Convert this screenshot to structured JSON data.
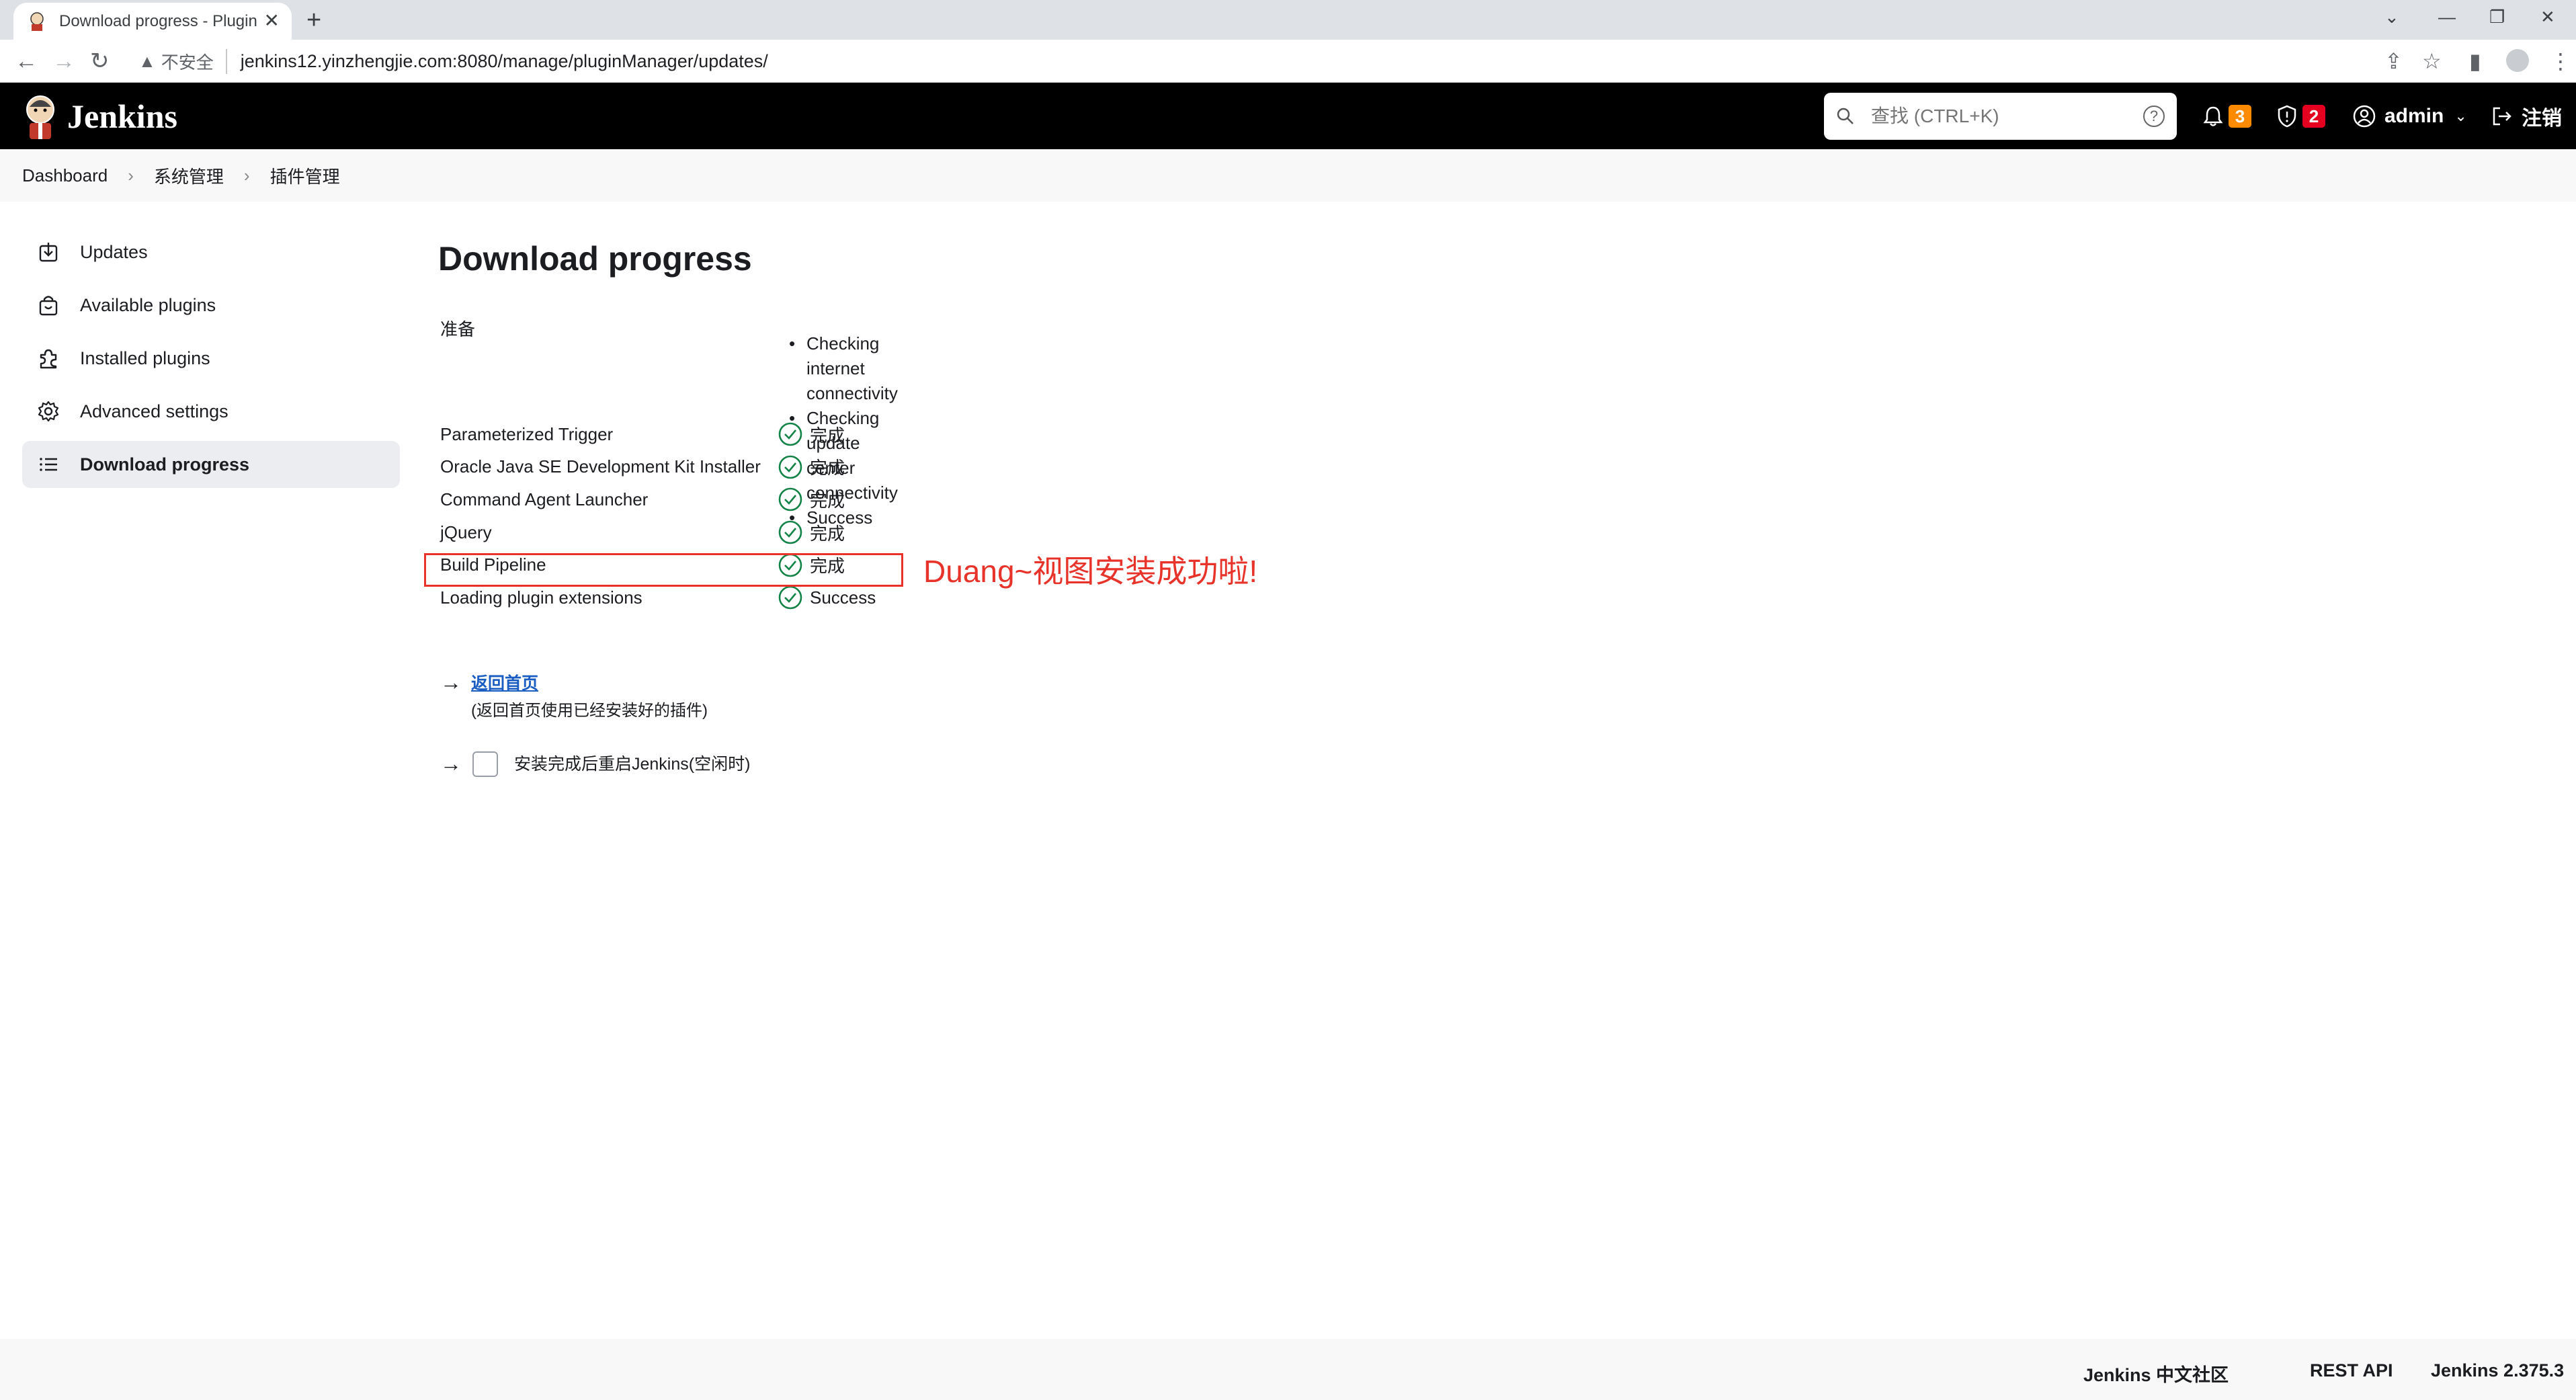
{
  "browser": {
    "tab_title": "Download progress - Plugin M",
    "insecure_label": "不安全",
    "url": "jenkins12.yinzhengjie.com:8080/manage/pluginManager/updates/"
  },
  "header": {
    "brand": "Jenkins",
    "search_placeholder": "查找 (CTRL+K)",
    "notifications_count": "3",
    "security_count": "2",
    "user": "admin",
    "logout": "注销"
  },
  "breadcrumb": [
    "Dashboard",
    "系统管理",
    "插件管理"
  ],
  "sidebar": {
    "items": [
      {
        "label": "Updates"
      },
      {
        "label": "Available plugins"
      },
      {
        "label": "Installed plugins"
      },
      {
        "label": "Advanced settings"
      },
      {
        "label": "Download progress"
      }
    ]
  },
  "main": {
    "title": "Download progress",
    "prep_label": "准备",
    "prep_steps": [
      "Checking internet connectivity",
      "Checking update center connectivity",
      "Success"
    ],
    "rows": [
      {
        "name": "Parameterized Trigger",
        "status": "完成"
      },
      {
        "name": "Oracle Java SE Development Kit Installer",
        "status": "完成"
      },
      {
        "name": "Command Agent Launcher",
        "status": "完成"
      },
      {
        "name": "jQuery",
        "status": "完成"
      },
      {
        "name": "Build Pipeline",
        "status": "完成"
      },
      {
        "name": "Loading plugin extensions",
        "status": "Success"
      }
    ],
    "annotation": "Duang~视图安装成功啦!",
    "home_link": "返回首页",
    "home_sub": "(返回首页使用已经安装好的插件)",
    "restart_label": "安装完成后重启Jenkins(空闲时)"
  },
  "footer": {
    "community": "Jenkins 中文社区",
    "rest_api": "REST API",
    "version": "Jenkins 2.375.3"
  },
  "colors": {
    "header_bg": "#000000",
    "success_green": "#138347",
    "annotation_red": "#e8332a",
    "notification_badge": "#fe8a00",
    "security_badge": "#e6001f",
    "link_blue": "#1a5dc2"
  },
  "icons": {
    "updates": "download-icon",
    "available": "shopping-bag-icon",
    "installed": "puzzle-icon",
    "advanced": "gear-icon",
    "progress": "list-icon",
    "status": "check-circle-icon"
  }
}
